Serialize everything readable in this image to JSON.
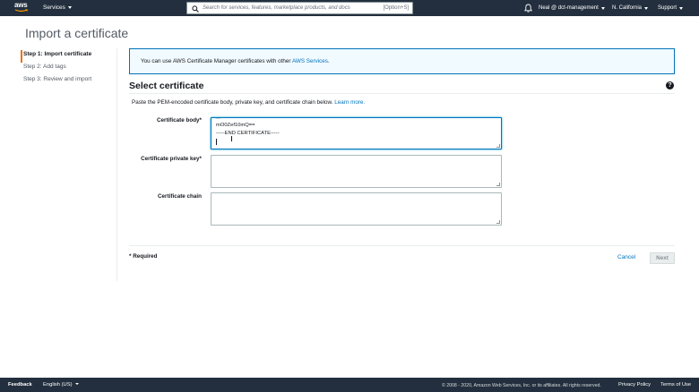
{
  "header": {
    "logo_text": "aws",
    "services_label": "Services",
    "search": {
      "placeholder": "Search for services, features, marketplace products, and docs",
      "shortcut": "[Option+S]"
    },
    "account_label": "Neal @ dct-management",
    "region_label": "N. California",
    "support_label": "Support"
  },
  "page": {
    "title": "Import a certificate"
  },
  "steps": [
    {
      "label": "Step 1: Import certificate",
      "active": true
    },
    {
      "label": "Step 2: Add tags",
      "active": false
    },
    {
      "label": "Step 3: Review and import",
      "active": false
    }
  ],
  "info": {
    "text": "You can use AWS Certificate Manager certificates with other ",
    "link": "AWS Services",
    "suffix": "."
  },
  "section": {
    "title": "Select certificate",
    "description": "Paste the PEM-encoded certificate body, private key, and certificate chain below. ",
    "learn_more": "Learn more."
  },
  "form": {
    "body": {
      "label": "Certificate body*",
      "lines": [
        "...",
        "mO0Zef10mQ==",
        "-----END CERTIFICATE-----"
      ]
    },
    "private_key": {
      "label": "Certificate private key*",
      "value": ""
    },
    "chain": {
      "label": "Certificate chain",
      "value": ""
    }
  },
  "actions": {
    "required_note": "* Required",
    "cancel_label": "Cancel",
    "next_label": "Next"
  },
  "footer": {
    "feedback": "Feedback",
    "language": "English (US)",
    "copyright": "© 2008 - 2020, Amazon Web Services, Inc. or its affiliates. All rights reserved.",
    "privacy": "Privacy Policy",
    "terms": "Terms of Use"
  },
  "colors": {
    "header_bg": "#232f3e",
    "link": "#0073bb",
    "accent": "#ec7211"
  }
}
